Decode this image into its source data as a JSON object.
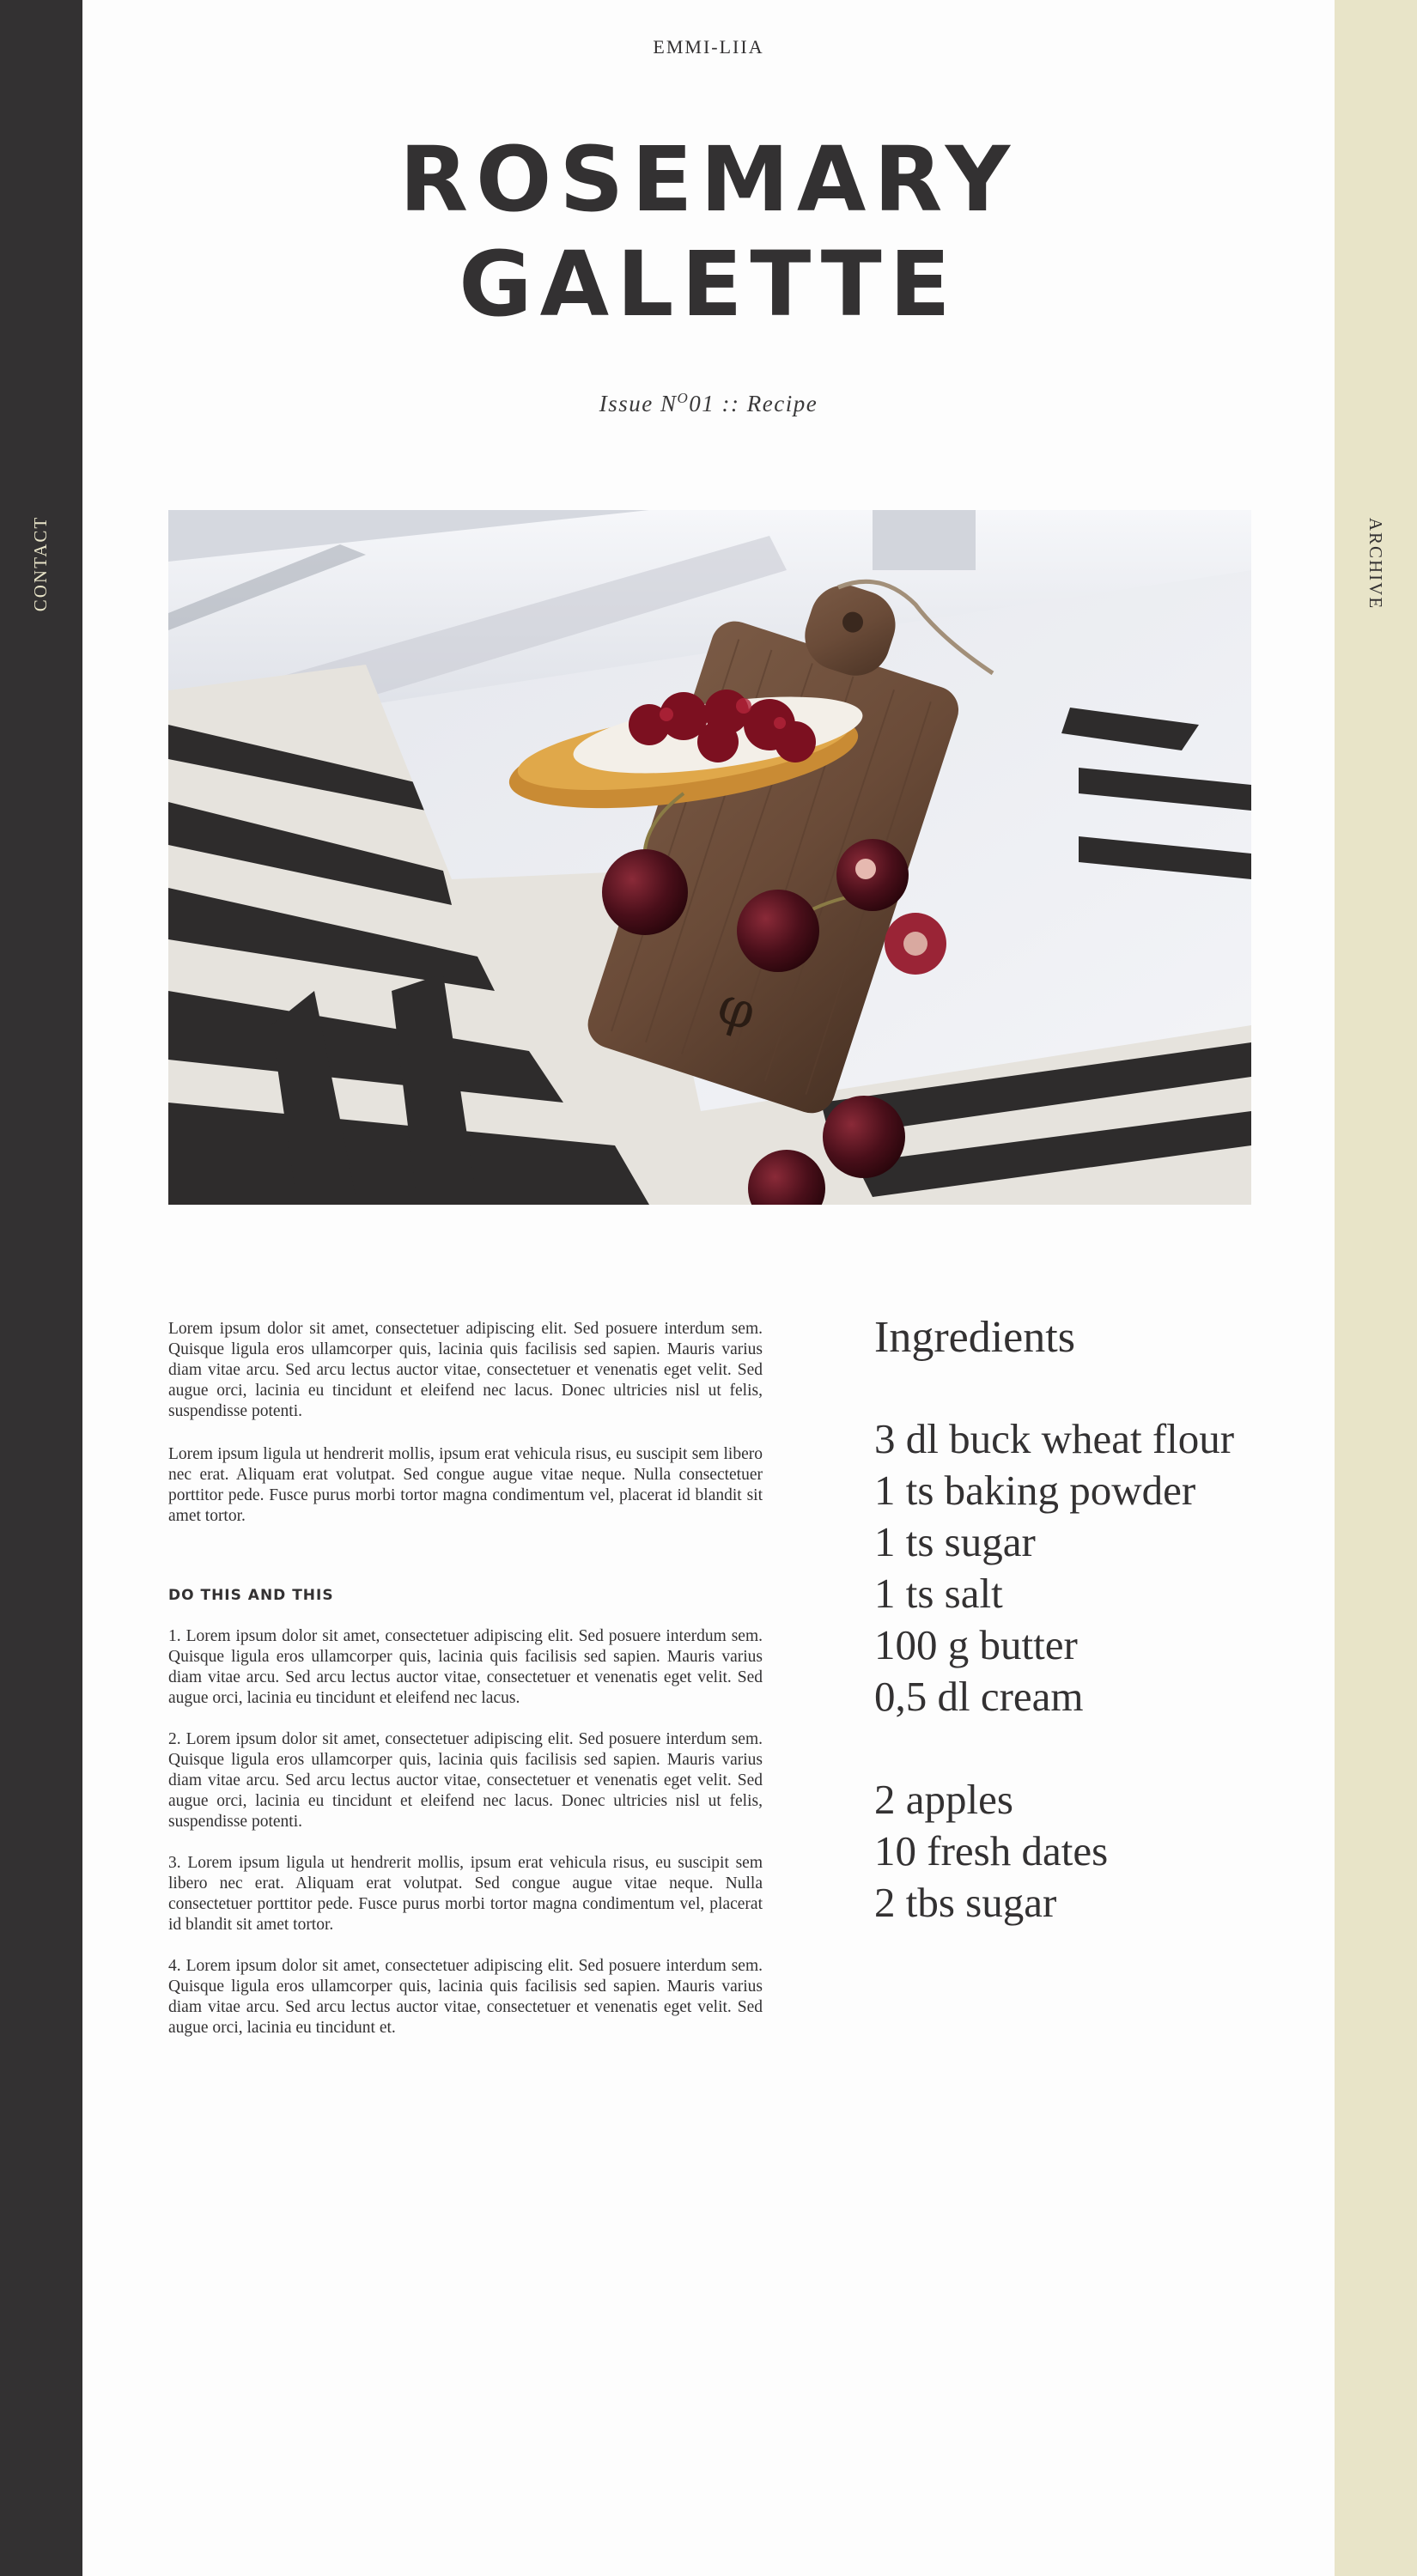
{
  "sidebar_left": {
    "label": "CONTACT"
  },
  "sidebar_right": {
    "label": "ARCHIVE"
  },
  "header": {
    "brand": "EMMI-LIIA",
    "title_lines": [
      "ROSEMARY",
      "GALETTE"
    ],
    "issue_prefix": "Issue N",
    "issue_sup": "O",
    "issue_suffix": "01 :: Recipe"
  },
  "hero_image": {
    "icon": "photo-toast-cherries-cutting-board"
  },
  "intro": [
    "Lorem ipsum dolor sit amet, consectetuer adipiscing elit. Sed posuere interdum sem. Quisque ligula eros ullamcorper quis, lacinia quis facilisis sed sapien. Mauris varius diam vitae arcu. Sed arcu lectus auctor vitae, consectetuer et venenatis eget velit. Sed augue orci, lacinia eu tincidunt et eleifend nec lacus. Donec ultricies nisl ut felis, suspendisse potenti.",
    "Lorem ipsum ligula ut hendrerit mollis, ipsum erat vehicula risus, eu suscipit sem libero nec erat. Aliquam erat volutpat. Sed congue augue vitae neque. Nulla consectetuer porttitor pede. Fusce purus morbi tortor magna condimentum vel, placerat id blandit sit amet tortor."
  ],
  "steps_heading": "DO THIS AND THIS",
  "steps": [
    "1. Lorem ipsum dolor sit amet, consectetuer adipiscing elit. Sed posuere interdum sem. Quisque ligula eros ullamcorper quis, lacinia quis facilisis sed sapien. Mauris varius diam vitae arcu. Sed arcu lectus auctor vitae, consectetuer et venenatis eget velit. Sed augue orci, lacinia eu tincidunt et eleifend nec lacus.",
    "2. Lorem ipsum dolor sit amet, consectetuer adipiscing elit. Sed posuere interdum sem. Quisque ligula eros ullamcorper quis, lacinia quis facilisis sed sapien. Mauris varius diam vitae arcu. Sed arcu lectus auctor vitae, consectetuer et venenatis eget velit. Sed augue orci, lacinia eu tincidunt et eleifend nec lacus. Donec ultricies nisl ut felis, suspendisse potenti.",
    "3. Lorem ipsum ligula ut hendrerit mollis, ipsum erat vehicula risus, eu suscipit sem libero nec erat. Aliquam erat volutpat. Sed congue augue vitae neque. Nulla consectetuer porttitor pede. Fusce purus morbi tortor magna condimentum vel, placerat id blandit sit amet tortor.",
    "4. Lorem ipsum dolor sit amet, consectetuer adipiscing elit. Sed posuere interdum sem. Quisque ligula eros ullamcorper quis, lacinia quis facilisis sed sapien. Mauris varius diam vitae arcu. Sed arcu lectus auctor vitae, consectetuer et venenatis eget velit. Sed augue orci, lacinia eu tincidunt et."
  ],
  "ingredients": {
    "heading": "Ingredients",
    "groups": [
      [
        "3 dl buck wheat flour",
        "1 ts baking powder",
        "1 ts sugar",
        "1 ts salt",
        "100 g butter",
        "0,5 dl cream"
      ],
      [
        "2 apples",
        "10 fresh dates",
        "2 tbs sugar"
      ]
    ]
  },
  "colors": {
    "left_bar": "#333132",
    "right_bar": "#e8e4c8",
    "text": "#333132",
    "background": "#fdfdfd"
  }
}
